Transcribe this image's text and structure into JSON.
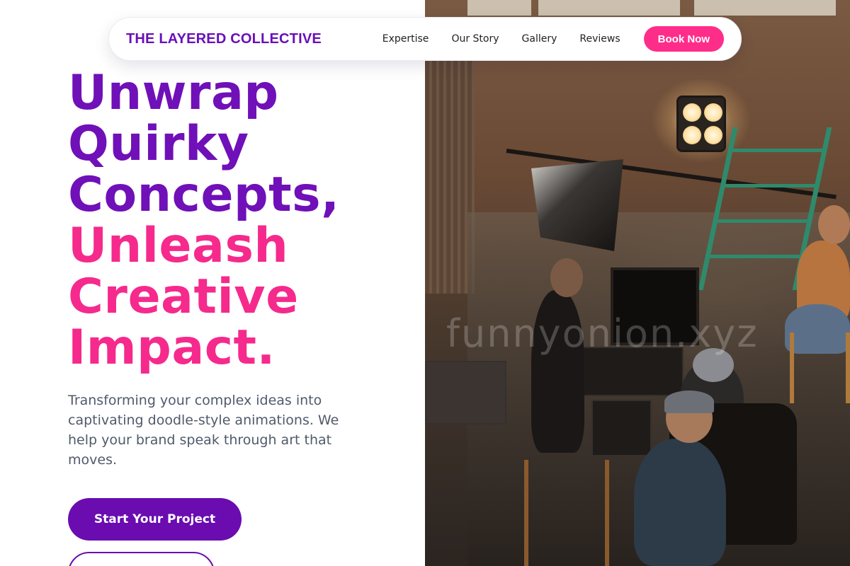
{
  "nav": {
    "brand": "THE LAYERED COLLECTIVE",
    "links": [
      "Expertise",
      "Our Story",
      "Gallery",
      "Reviews"
    ],
    "cta_label": "Book Now"
  },
  "hero": {
    "headline_purple": [
      "Unwrap",
      "Quirky",
      "Concepts,"
    ],
    "headline_pink": [
      "Unleash",
      "Creative",
      "Impact."
    ],
    "subtext": "Transforming your complex ideas into captivating doodle-style animations. We help your brand speak through art that moves.",
    "primary_cta": "Start Your Project",
    "secondary_cta": ""
  },
  "image": {
    "watermark": "funnyonion.xyz"
  },
  "colors": {
    "purple": "#7010b8",
    "pink": "#f52a8c",
    "button_purple": "#6a0cb0",
    "nav_button_pink": "#ff2d8a",
    "body_text": "#505a6b"
  }
}
